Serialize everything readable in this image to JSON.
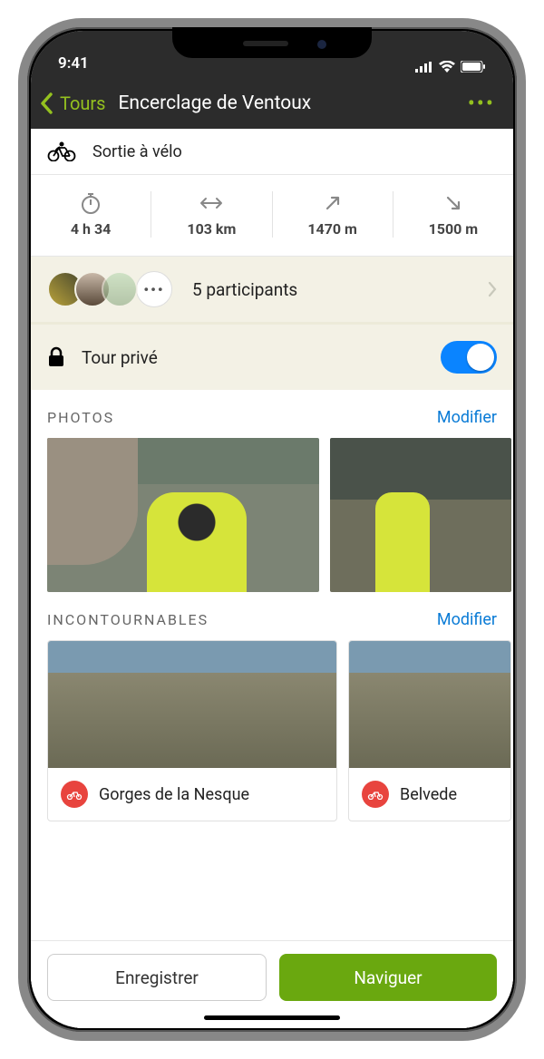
{
  "status": {
    "time": "9:41"
  },
  "nav": {
    "back": "Tours",
    "title": "Encerclage de Ventoux"
  },
  "activity": {
    "label": "Sortie à vélo"
  },
  "stats": {
    "duration": "4 h 34",
    "distance": "103 km",
    "ascent": "1470 m",
    "descent": "1500 m"
  },
  "participants": {
    "label": "5 participants"
  },
  "privacy": {
    "label": "Tour privé",
    "enabled": true
  },
  "sections": {
    "photos": {
      "title": "PHOTOS",
      "edit": "Modifier"
    },
    "highlights": {
      "title": "INCONTOURNABLES",
      "edit": "Modifier"
    }
  },
  "highlights": [
    {
      "title": "Gorges de la Nesque"
    },
    {
      "title": "Belvede"
    }
  ],
  "buttons": {
    "save": "Enregistrer",
    "navigate": "Naviguer"
  }
}
